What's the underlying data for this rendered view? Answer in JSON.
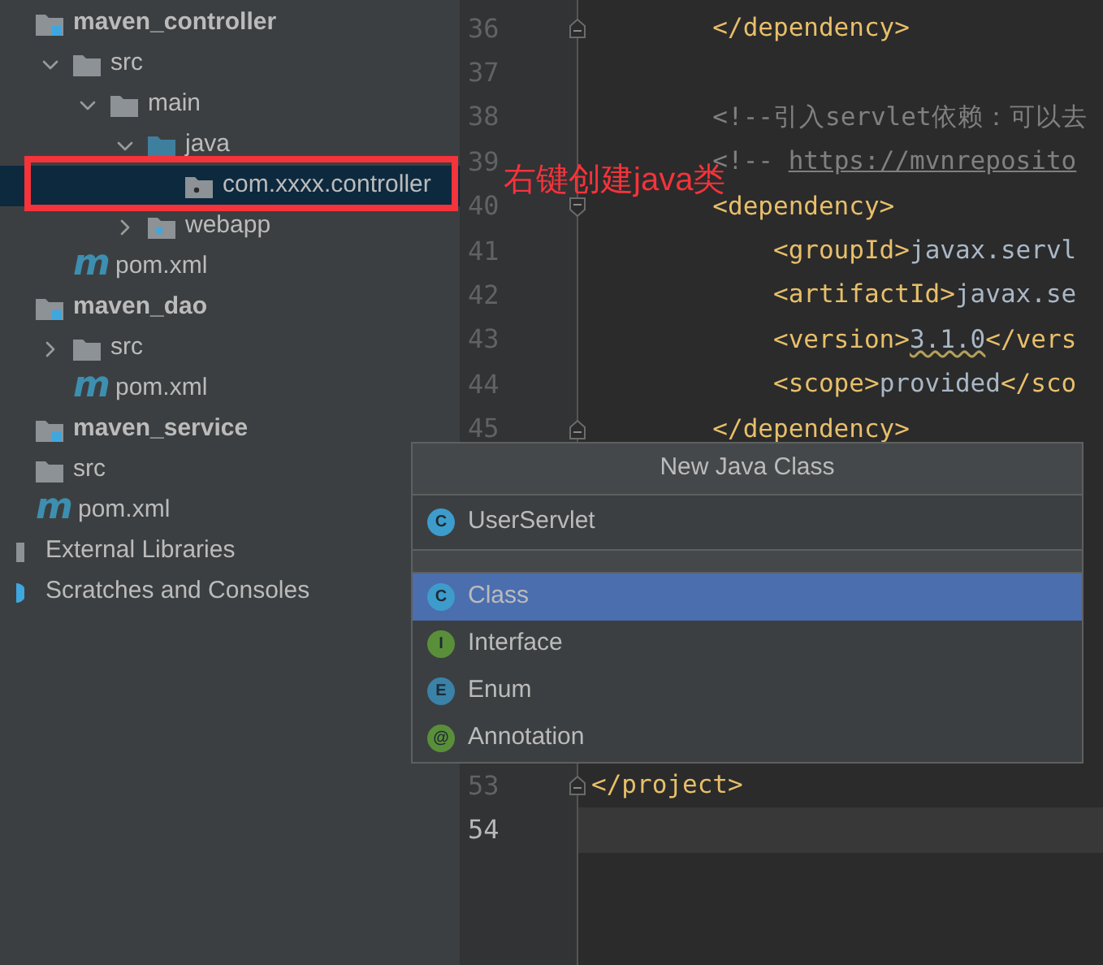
{
  "project_tree": [
    {
      "label": "maven_controller",
      "kind": "module",
      "selected": false,
      "children": [
        {
          "label": "src",
          "kind": "folder",
          "expanded": true,
          "selected": false,
          "children": [
            {
              "label": "main",
              "kind": "folder",
              "expanded": true,
              "selected": false,
              "children": [
                {
                  "label": "java",
                  "kind": "source-folder",
                  "expanded": true,
                  "selected": false,
                  "children": [
                    {
                      "label": "com.xxxx.controller",
                      "kind": "package",
                      "selected": true
                    }
                  ]
                },
                {
                  "label": "webapp",
                  "kind": "web-folder",
                  "expanded": false,
                  "selected": false
                }
              ]
            }
          ]
        },
        {
          "label": "pom.xml",
          "kind": "maven-file",
          "badge": "m",
          "selected": false
        }
      ]
    },
    {
      "label": "maven_dao",
      "kind": "module",
      "selected": false,
      "children": [
        {
          "label": "src",
          "kind": "folder",
          "expanded": false,
          "selected": false
        },
        {
          "label": "pom.xml",
          "kind": "maven-file",
          "badge": "m",
          "selected": false
        }
      ]
    },
    {
      "label": "maven_service",
      "kind": "module",
      "selected": false
    },
    {
      "label": "src",
      "kind": "folder",
      "selected": false
    },
    {
      "label": "pom.xml",
      "kind": "maven-file",
      "badge": "m",
      "selected": false
    },
    {
      "label": "External Libraries",
      "kind": "libraries",
      "selected": false
    },
    {
      "label": "Scratches and Consoles",
      "kind": "scratches",
      "selected": false
    }
  ],
  "editor": {
    "lines": [
      {
        "number": "36",
        "fold_start": false,
        "fold_end": true,
        "current": false,
        "tokens": [
          {
            "kind": "tag",
            "text": "        </dependency>"
          }
        ]
      },
      {
        "number": "37",
        "fold_start": false,
        "fold_end": false,
        "current": false
      },
      {
        "number": "38",
        "fold_start": false,
        "fold_end": false,
        "current": false,
        "tokens": [
          {
            "kind": "comment",
            "text": "        <!--引入servlet依赖：可以去"
          }
        ]
      },
      {
        "number": "39",
        "fold_start": false,
        "fold_end": false,
        "current": false,
        "tokens": [
          {
            "kind": "comment",
            "text": "        <!-- "
          },
          {
            "kind": "link",
            "text": "https://mvnreposito"
          }
        ]
      },
      {
        "number": "40",
        "fold_start": true,
        "fold_end": false,
        "current": false,
        "tokens": [
          {
            "kind": "tag",
            "text": "        <dependency>"
          }
        ]
      },
      {
        "number": "41",
        "fold_start": false,
        "fold_end": false,
        "current": false,
        "tokens": [
          {
            "kind": "tag",
            "text": "            <groupId>"
          },
          {
            "kind": "text",
            "text": "javax.servl"
          }
        ]
      },
      {
        "number": "42",
        "fold_start": false,
        "fold_end": false,
        "current": false,
        "tokens": [
          {
            "kind": "tag",
            "text": "            <artifactId>"
          },
          {
            "kind": "text",
            "text": "javax.se"
          }
        ]
      },
      {
        "number": "43",
        "fold_start": false,
        "fold_end": false,
        "current": false,
        "tokens": [
          {
            "kind": "tag",
            "text": "            <version>"
          },
          {
            "kind": "warn",
            "text": "3.1.0"
          },
          {
            "kind": "tag",
            "text": "</vers"
          }
        ]
      },
      {
        "number": "44",
        "fold_start": false,
        "fold_end": false,
        "current": false,
        "tokens": [
          {
            "kind": "tag",
            "text": "            <scope>"
          },
          {
            "kind": "text",
            "text": "provided"
          },
          {
            "kind": "tag",
            "text": "</sco"
          }
        ]
      },
      {
        "number": "45",
        "fold_start": false,
        "fold_end": true,
        "current": false,
        "tokens": [
          {
            "kind": "tag",
            "text": "        </dependency>"
          }
        ]
      },
      {
        "number": "53",
        "fold_start": false,
        "fold_end": true,
        "current": false,
        "tokens": [
          {
            "kind": "tag",
            "text": "</project>"
          }
        ]
      },
      {
        "number": "54",
        "fold_start": false,
        "fold_end": false,
        "current": true
      }
    ]
  },
  "annotation": {
    "text": "右键创建java类"
  },
  "dialog": {
    "title": "New Java Class",
    "name_field": {
      "badge": "C",
      "value": "UserServlet"
    },
    "kinds": [
      {
        "label": "Class",
        "kind": "class",
        "badge": "C",
        "selected": true
      },
      {
        "label": "Interface",
        "kind": "interface",
        "badge": "I",
        "selected": false
      },
      {
        "label": "Enum",
        "kind": "enum",
        "badge": "E",
        "selected": false
      },
      {
        "label": "Annotation",
        "kind": "annotation",
        "badge": "@",
        "selected": false
      }
    ]
  }
}
